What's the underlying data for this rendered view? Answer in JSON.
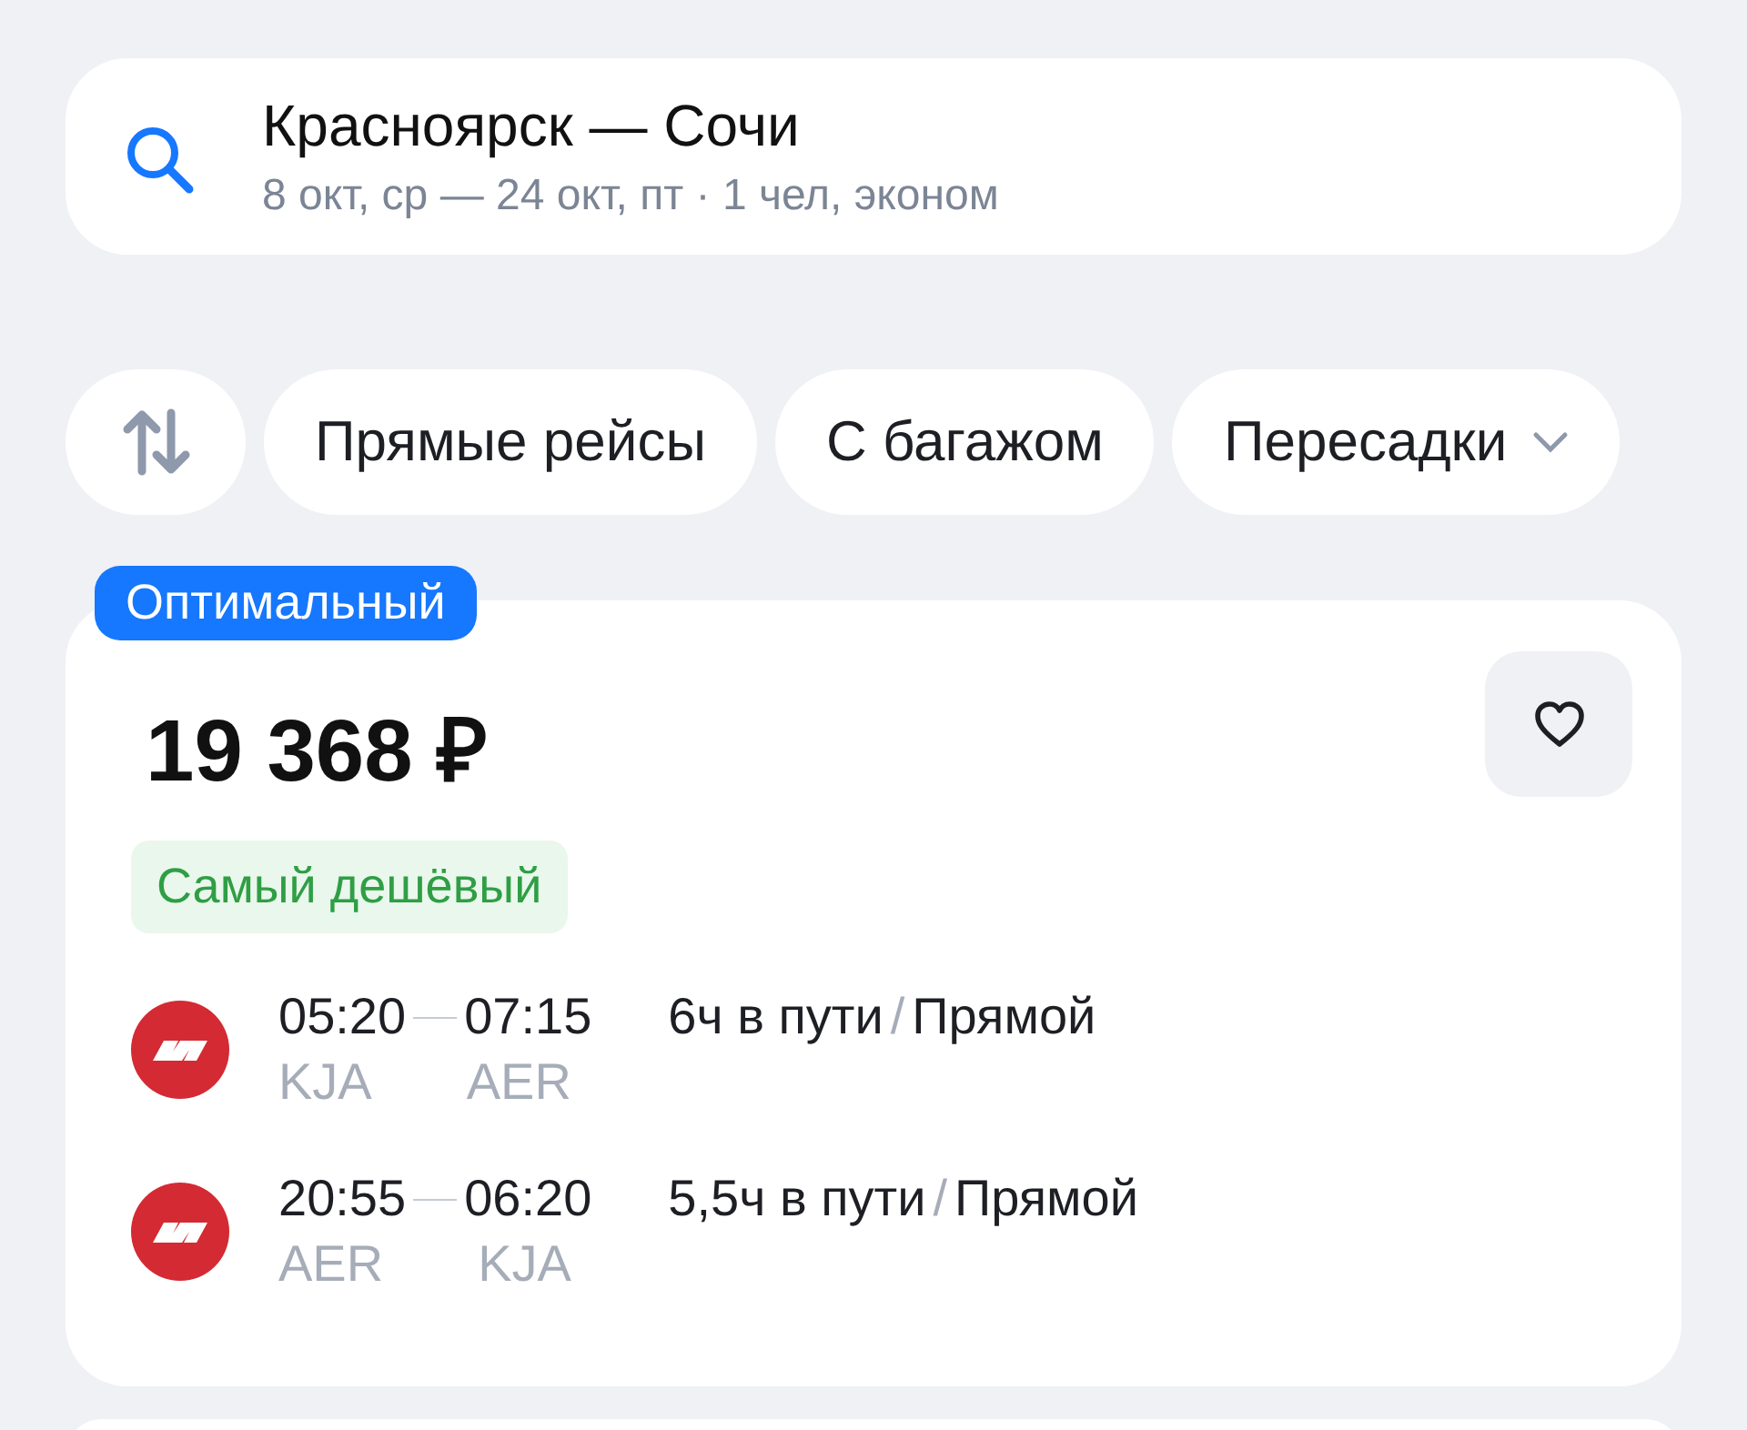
{
  "search": {
    "route": "Красноярск — Сочи",
    "details": "8 окт, ср — 24 окт, пт · 1 чел, эконом"
  },
  "filters": [
    {
      "kind": "sort"
    },
    {
      "kind": "chip",
      "label": "Прямые рейсы"
    },
    {
      "kind": "chip",
      "label": "С багажом"
    },
    {
      "kind": "dropdown",
      "label": "Пересадки"
    }
  ],
  "offer": {
    "badge": "Оптимальный",
    "price": "19 368 ₽",
    "favorite": false,
    "tag": "Самый дешёвый",
    "flights": [
      {
        "depart_time": "05:20",
        "arrive_time": "07:15",
        "depart_airport": "KJA",
        "arrive_airport": "AER",
        "duration": "6ч в пути",
        "divider": "/",
        "stops": "Прямой"
      },
      {
        "depart_time": "20:55",
        "arrive_time": "06:20",
        "depart_airport": "AER",
        "arrive_airport": "KJA",
        "duration": "5,5ч в пути",
        "divider": "/",
        "stops": "Прямой"
      }
    ]
  }
}
